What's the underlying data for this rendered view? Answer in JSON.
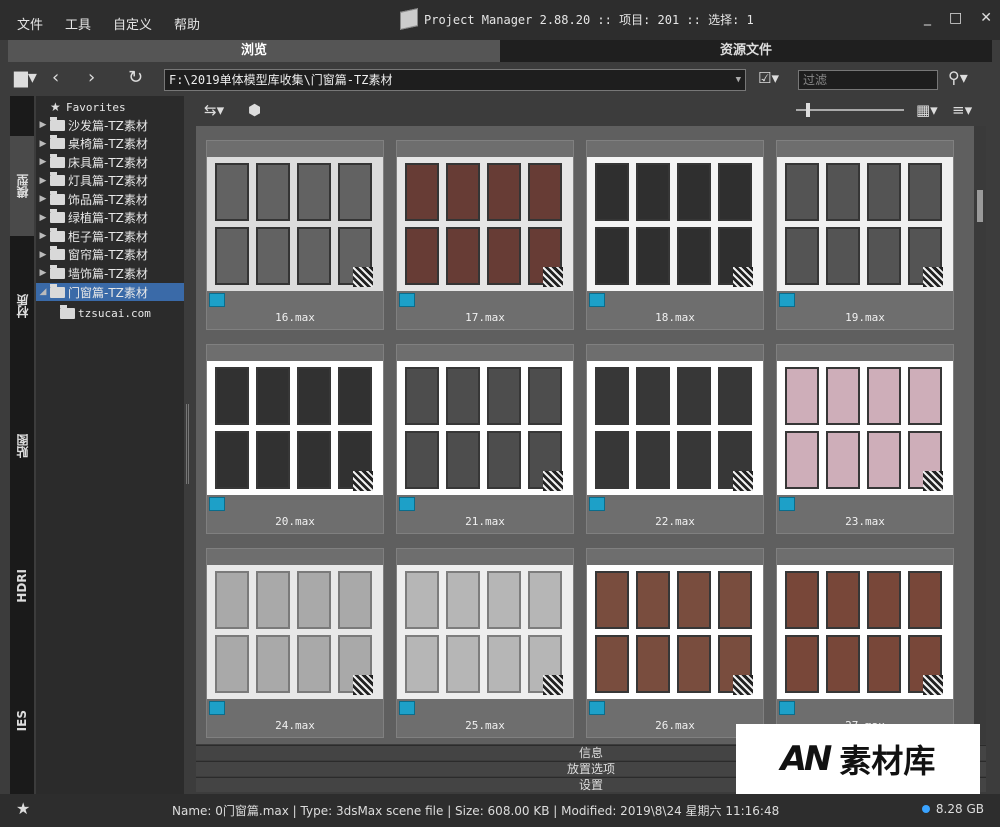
{
  "menu": [
    "文件",
    "工具",
    "自定义",
    "帮助"
  ],
  "app_title": "Project Manager 2.88.20  :: 项目: 201  :: 选择: 1",
  "window_controls": [
    "_",
    "□",
    "✕"
  ],
  "top_tabs": [
    "浏览",
    "资源文件"
  ],
  "nav": {
    "path": "F:\\2019单体模型库收集\\门窗篇-TZ素材",
    "filter_placeholder": "过滤"
  },
  "vertical_tabs": [
    "模型",
    "材质",
    "贴图",
    "HDRI",
    "IES"
  ],
  "tree": {
    "favorites": "Favorites",
    "folders": [
      "沙发篇-TZ素材",
      "桌椅篇-TZ素材",
      "床具篇-TZ素材",
      "灯具篇-TZ素材",
      "饰品篇-TZ素材",
      "绿植篇-TZ素材",
      "柜子篇-TZ素材",
      "窗帘篇-TZ素材",
      "墙饰篇-TZ素材",
      "门窗篇-TZ素材"
    ],
    "subfolder": "tzsucai.com"
  },
  "grid": {
    "items": [
      "16.max",
      "17.max",
      "18.max",
      "19.max",
      "20.max",
      "21.max",
      "22.max",
      "23.max",
      "24.max",
      "25.max",
      "26.max",
      "27.max"
    ]
  },
  "bottom_panels": [
    "信息",
    "放置选项",
    "设置"
  ],
  "status": {
    "text": "Name: 0门窗篇.max | Type: 3dsMax scene file | Size: 608.00 KB | Modified: 2019\\8\\24 星期六 11:16:48",
    "disk": "8.28 GB"
  },
  "watermark": {
    "logo": "AN",
    "name": "素材库"
  },
  "colors": {
    "selection": "#3a6aa8",
    "max_icon": "#1da0c8"
  }
}
